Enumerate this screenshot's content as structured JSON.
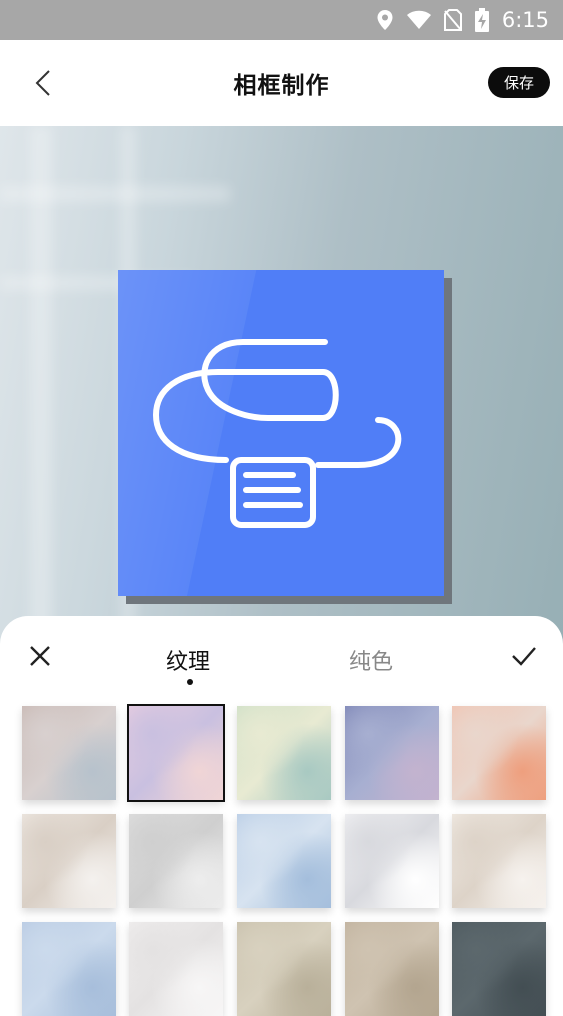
{
  "status_bar": {
    "time": "6:15"
  },
  "header": {
    "title": "相框制作",
    "save_label": "保存"
  },
  "tabs": [
    {
      "label": "纹理"
    },
    {
      "label": "纯色"
    }
  ],
  "texture_tiles": [
    {
      "name": "texture-1",
      "colors": [
        "#c9b9b4",
        "#d8d0cf",
        "#b7c2cc"
      ]
    },
    {
      "name": "texture-2",
      "colors": [
        "#e8cde0",
        "#c9c0e0",
        "#f0d5d6"
      ],
      "selected": true
    },
    {
      "name": "texture-3",
      "colors": [
        "#cfe0c8",
        "#e8ead2",
        "#a8c9c2"
      ]
    },
    {
      "name": "texture-4",
      "colors": [
        "#7e86b6",
        "#a7afd1",
        "#c3b3cf"
      ]
    },
    {
      "name": "texture-5",
      "colors": [
        "#f1c4b2",
        "#e9d6cc",
        "#ee9f7e"
      ]
    },
    {
      "name": "texture-6",
      "colors": [
        "#eee8e2",
        "#d9cfc5",
        "#f4f1ee"
      ]
    },
    {
      "name": "texture-7",
      "colors": [
        "#dedede",
        "#cfcfcf",
        "#ededed"
      ]
    },
    {
      "name": "texture-8",
      "colors": [
        "#b9cde6",
        "#d7e3f0",
        "#a4bedc"
      ]
    },
    {
      "name": "texture-9",
      "colors": [
        "#f2f2f4",
        "#d8d9de",
        "#ffffff"
      ]
    },
    {
      "name": "texture-10",
      "colors": [
        "#f1ebe4",
        "#ddd3c8",
        "#f6f2ee"
      ]
    },
    {
      "name": "texture-11",
      "colors": [
        "#b9cbe3",
        "#cbdaec",
        "#a7bedb"
      ]
    },
    {
      "name": "texture-12",
      "colors": [
        "#f0eeee",
        "#e4e2e2",
        "#f7f6f6"
      ]
    },
    {
      "name": "texture-13",
      "colors": [
        "#c9c1ad",
        "#d8d1bf",
        "#b9b09a"
      ]
    },
    {
      "name": "texture-14",
      "colors": [
        "#c1b39f",
        "#cfc3b1",
        "#b3a58f"
      ]
    },
    {
      "name": "texture-15",
      "colors": [
        "#4e5a5f",
        "#5c686d",
        "#434e53"
      ]
    }
  ],
  "colors": {
    "accent": "#507ef7",
    "save_button": "#0c0c0c"
  }
}
